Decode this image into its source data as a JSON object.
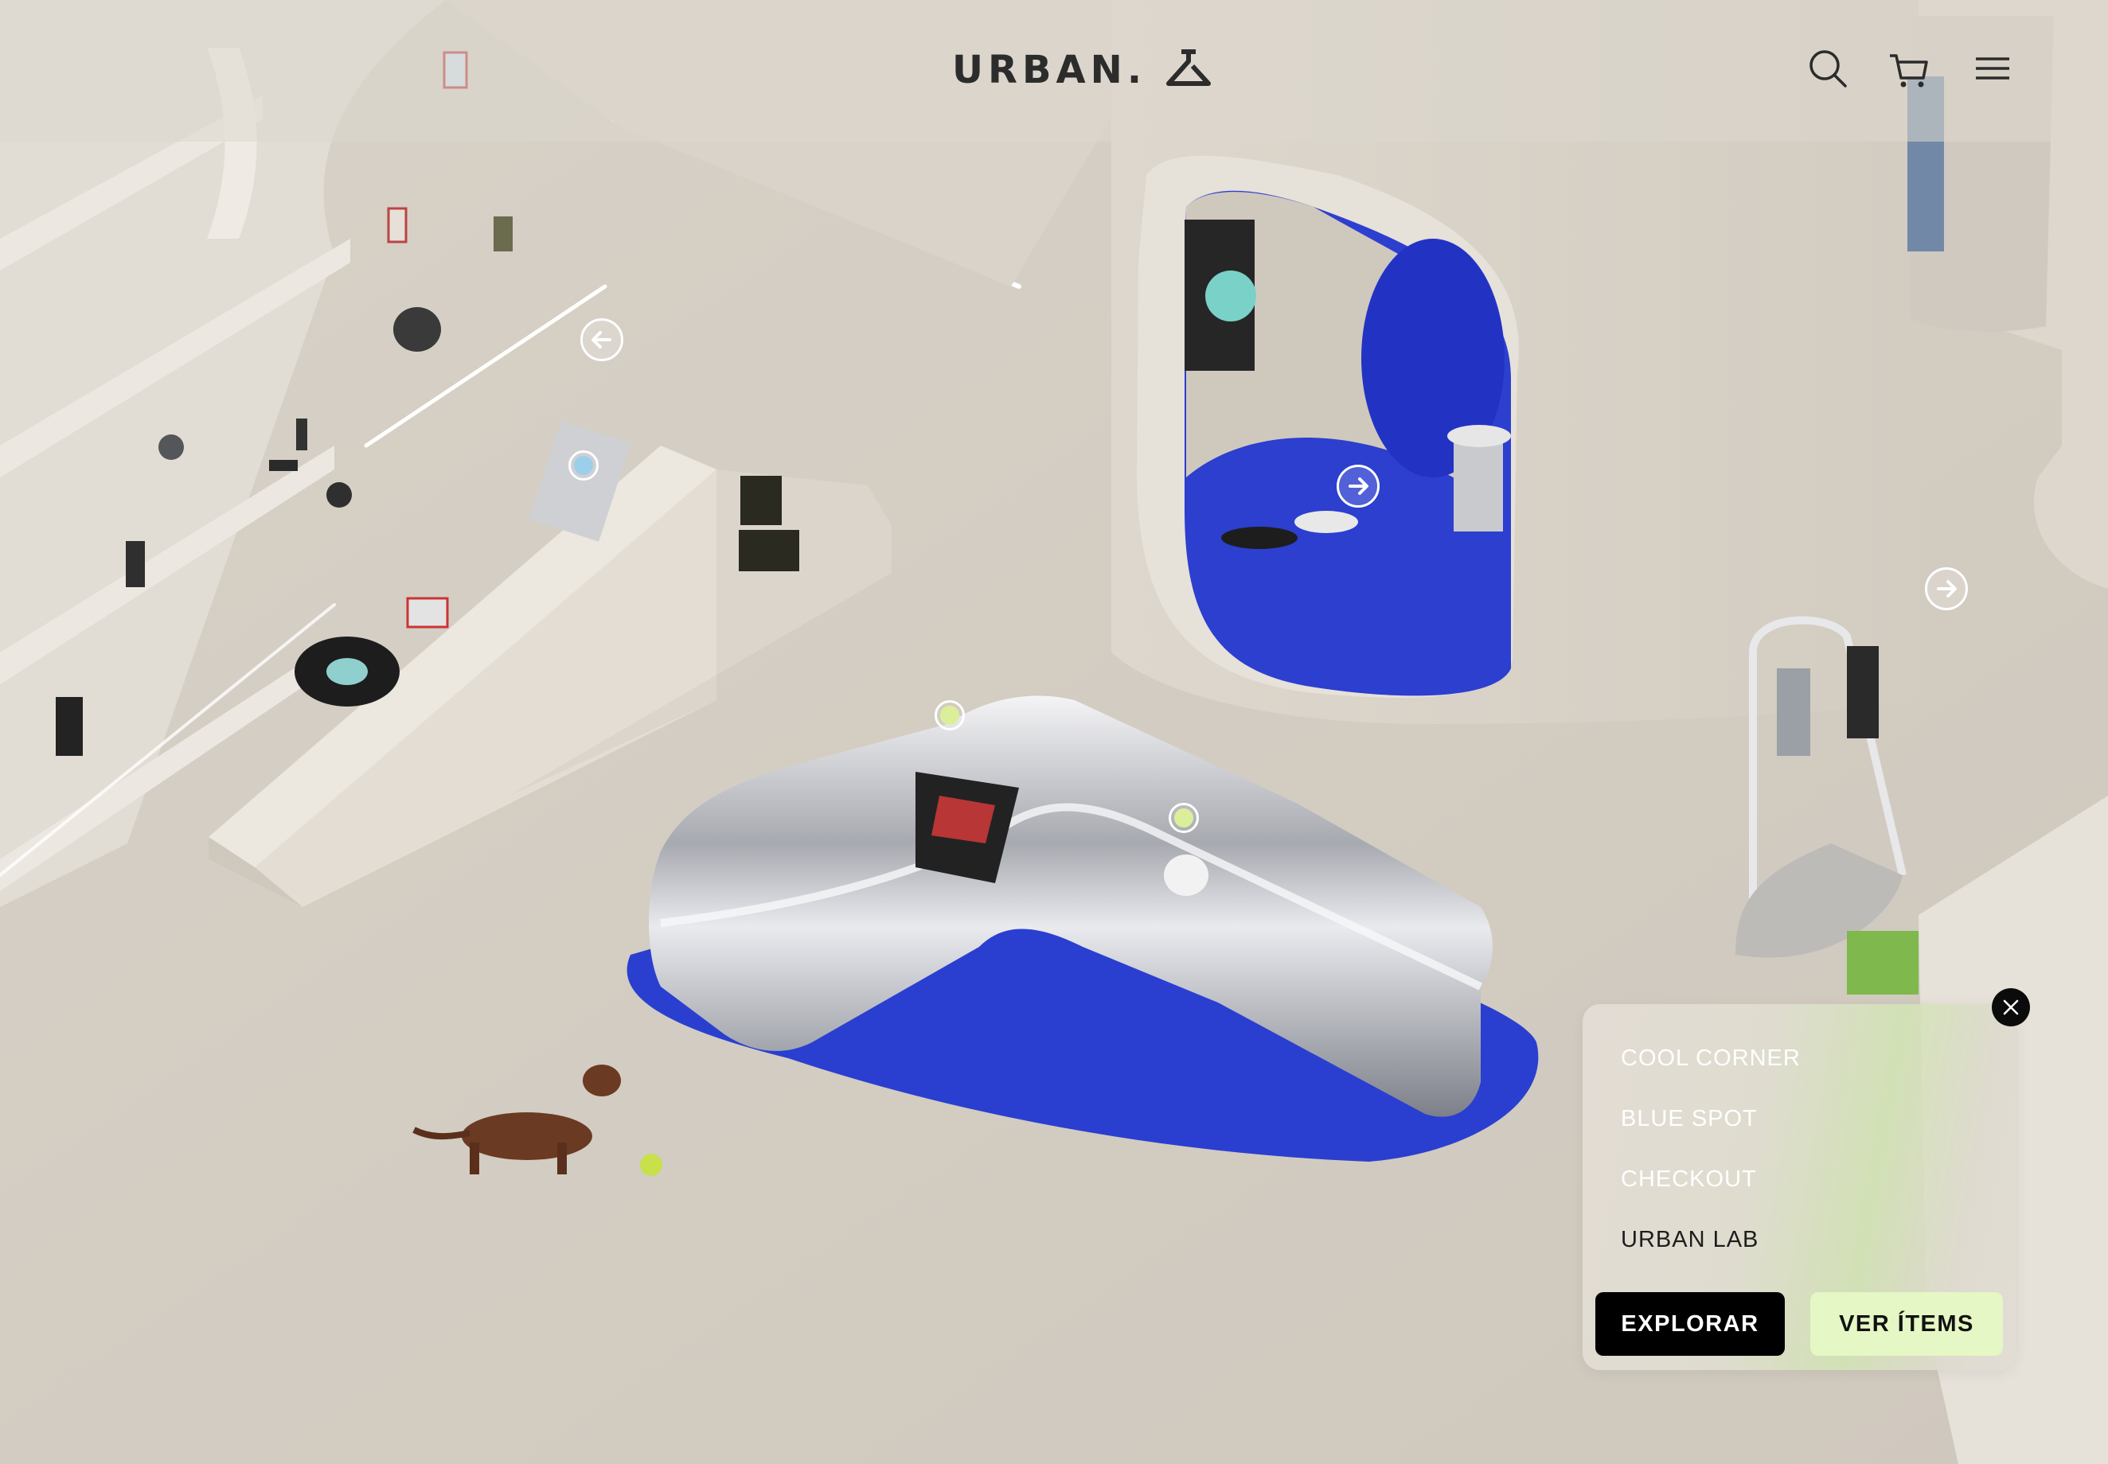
{
  "header": {
    "logo_text": "URBAN.",
    "logo_icon": "hanger-icon",
    "icons": [
      "search-icon",
      "cart-icon",
      "menu-icon"
    ]
  },
  "hotspots": {
    "arrows": [
      "arrow-left",
      "arrow-right",
      "arrow-right"
    ],
    "dot_colors": [
      "#9ccfe9",
      "#dbef9a",
      "#dbef9a"
    ]
  },
  "zones_panel": {
    "items": [
      "COOL CORNER",
      "BLUE SPOT",
      "CHECKOUT",
      "URBAN LAB"
    ],
    "active_index": 3,
    "explore_label": "EXPLORAR",
    "items_label": "VER ÍTEMS"
  },
  "colors": {
    "accent_blue": "#2a3fd0",
    "accent_lime": "#e4f7c4",
    "dark": "#0b0b0b"
  }
}
